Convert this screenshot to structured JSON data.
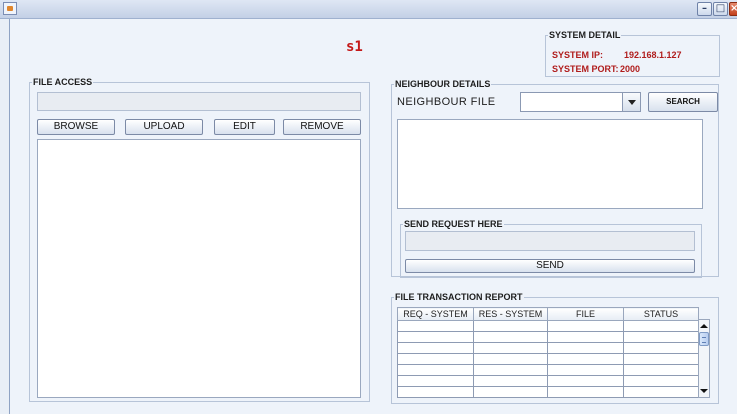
{
  "window": {
    "title": "",
    "controls": [
      "minimize-icon",
      "maximize-icon",
      "close-icon"
    ]
  },
  "header": {
    "node_name": "s1"
  },
  "system_detail": {
    "legend": "SYSTEM DETAIL",
    "ip_label": "SYSTEM IP:",
    "ip_value": "192.168.1.127",
    "port_label": "SYSTEM PORT:",
    "port_value": "2000"
  },
  "file_access": {
    "legend": "FILE ACCESS",
    "path_value": "",
    "buttons": {
      "browse": "BROWSE",
      "upload": "UPLOAD",
      "edit": "EDIT",
      "remove": "REMOVE"
    },
    "content_text": ""
  },
  "neighbour_details": {
    "legend": "NEIGHBOUR DETAILS",
    "file_label": "NEIGHBOUR FILE",
    "file_selected": "",
    "search_label": "SEARCH",
    "results_text": ""
  },
  "send_request": {
    "legend": "SEND REQUEST HERE",
    "request_value": "",
    "send_label": "SEND"
  },
  "transaction_report": {
    "legend": "FILE TRANSACTION REPORT",
    "columns": [
      "REQ - SYSTEM",
      "RES - SYSTEM",
      "FILE",
      "STATUS"
    ],
    "rows": [
      [
        "",
        "",
        "",
        ""
      ],
      [
        "",
        "",
        "",
        ""
      ],
      [
        "",
        "",
        "",
        ""
      ],
      [
        "",
        "",
        "",
        ""
      ],
      [
        "",
        "",
        "",
        ""
      ],
      [
        "",
        "",
        "",
        ""
      ],
      [
        "",
        "",
        "",
        ""
      ]
    ]
  },
  "colors": {
    "accent_red": "#c41818",
    "panel_bg": "#eef3fa"
  }
}
